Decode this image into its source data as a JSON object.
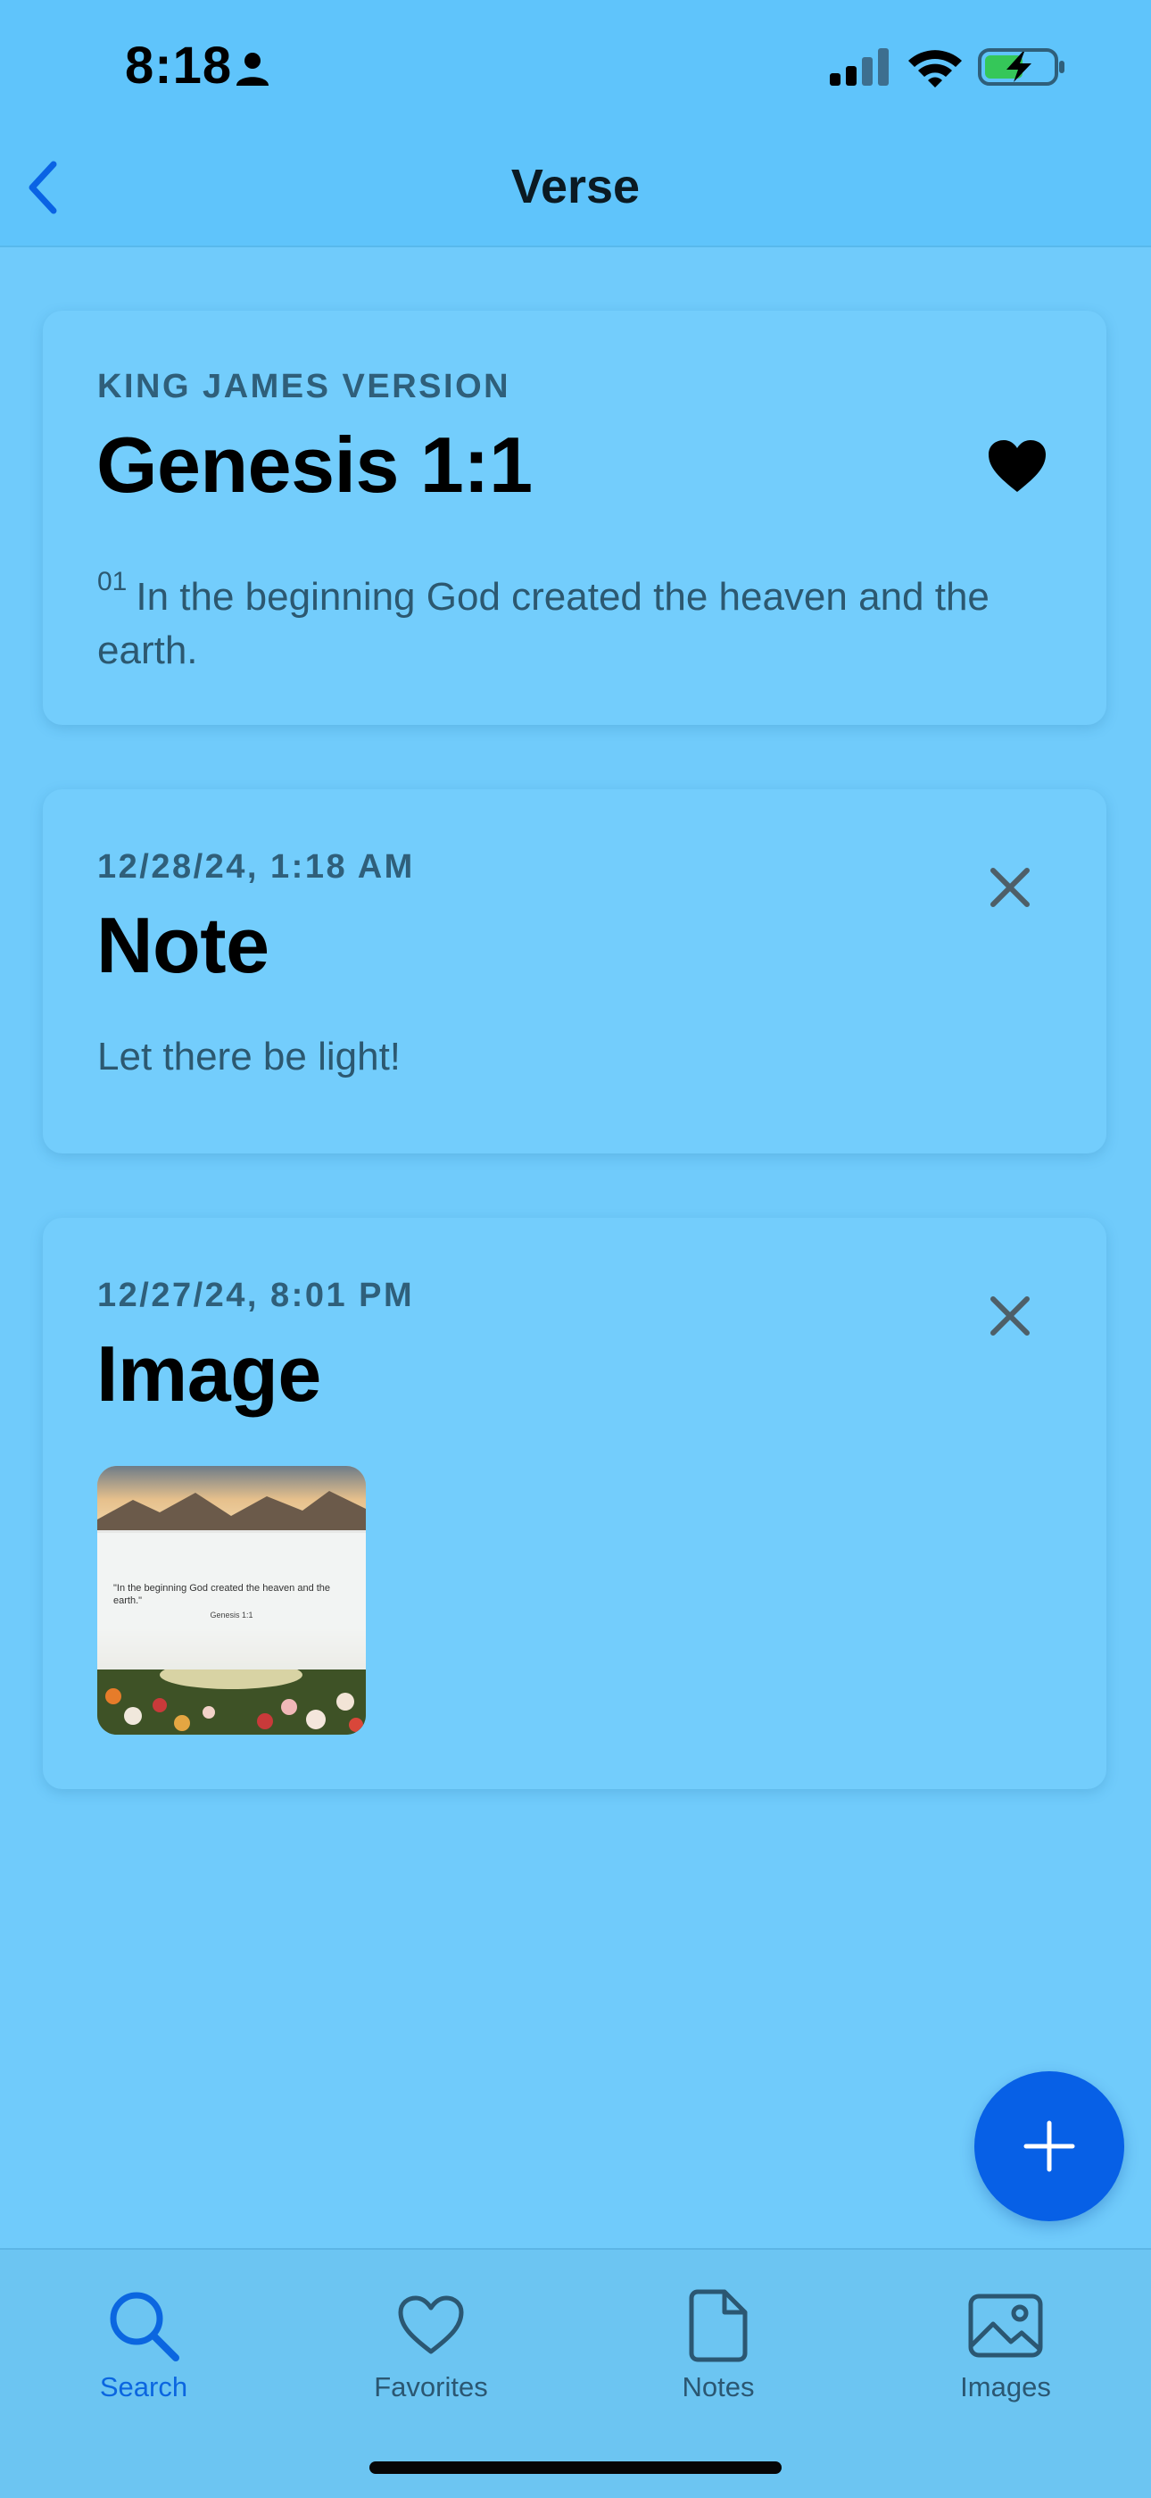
{
  "status_bar": {
    "time": "8:18"
  },
  "nav": {
    "title": "Verse"
  },
  "verse_card": {
    "version": "KING JAMES VERSION",
    "reference": "Genesis 1:1",
    "verse_number": "01",
    "verse_text": "In the beginning God created the heaven and the earth.",
    "favorited": true
  },
  "note_card": {
    "timestamp": "12/28/24, 1:18 AM",
    "heading": "Note",
    "text": "Let there be light!"
  },
  "image_card": {
    "timestamp": "12/27/24, 8:01 PM",
    "heading": "Image",
    "thumbnail": {
      "quote": "\"In the beginning God created the heaven and the earth.\"",
      "reference": "Genesis 1:1"
    }
  },
  "tabs": [
    {
      "label": "Search",
      "icon": "search-icon",
      "active": true
    },
    {
      "label": "Favorites",
      "icon": "heart-icon",
      "active": false
    },
    {
      "label": "Notes",
      "icon": "document-icon",
      "active": false
    },
    {
      "label": "Images",
      "icon": "photo-icon",
      "active": false
    }
  ],
  "colors": {
    "background": "#70cbfb",
    "accent": "#0760e6",
    "active_tab": "#0b66e0",
    "inactive_tab": "#2b5772"
  }
}
